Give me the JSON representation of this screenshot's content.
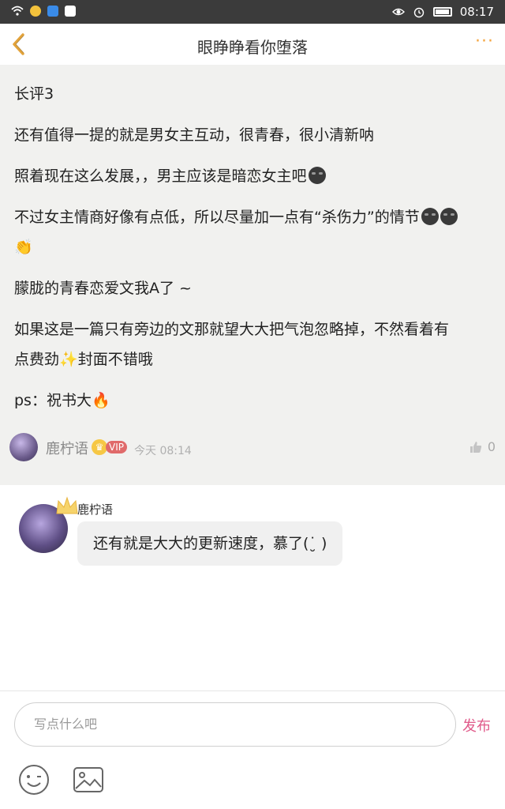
{
  "status_bar": {
    "time": "08:17"
  },
  "nav": {
    "title": "眼睁睁看你堕落",
    "more": "···"
  },
  "post": {
    "lines": [
      "长评3",
      "还有值得一提的就是男女主互动，很青春，很小清新呐",
      "照着现在这么发展，，男主应该是暗恋女主吧",
      "不过女主情商好像有点低，所以尽量加一点有“杀伤力”的情节",
      "朦胧的青春恋爱文我A了 ~",
      "如果这是一篇只有旁边的文那就望大大把气泡忽略掉，不然看着有",
      "点费劲",
      "封面不错哦",
      "ps：祝书大"
    ],
    "clap_emoji": "👏",
    "sparkle_emoji": "✨",
    "fire_emoji": "🔥",
    "author": {
      "name": "鹿柠语",
      "vip": "VIP",
      "time": "今天 08:14"
    },
    "likes": "0"
  },
  "reply": {
    "name": "鹿柠语",
    "text": "还有就是大大的更新速度，慕了(˙̮ )"
  },
  "composer": {
    "placeholder": "写点什么吧",
    "send_label": "发布"
  },
  "colors": {
    "accent_orange": "#f4a642",
    "send_pink": "#e05a8a",
    "post_bg": "#f1f1ef"
  }
}
